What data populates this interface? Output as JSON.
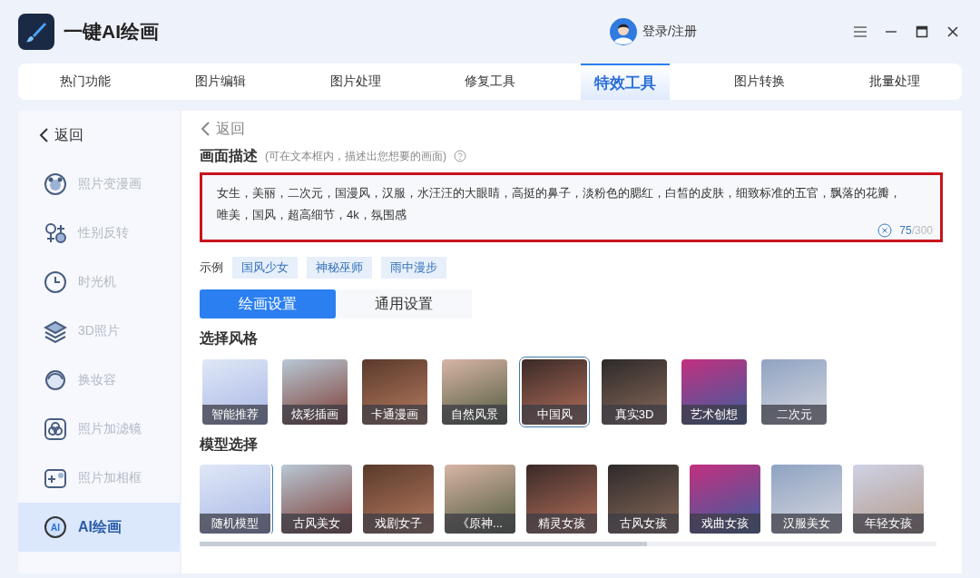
{
  "app": {
    "title": "一键AI绘画",
    "login": "登录/注册"
  },
  "tabs": [
    {
      "label": "热门功能",
      "selected": false
    },
    {
      "label": "图片编辑",
      "selected": false
    },
    {
      "label": "图片处理",
      "selected": false
    },
    {
      "label": "修复工具",
      "selected": false
    },
    {
      "label": "特效工具",
      "selected": true
    },
    {
      "label": "图片转换",
      "selected": false
    },
    {
      "label": "批量处理",
      "selected": false
    }
  ],
  "sidebar": {
    "back": "返回",
    "items": [
      {
        "label": "照片变漫画",
        "selected": false
      },
      {
        "label": "性别反转",
        "selected": false
      },
      {
        "label": "时光机",
        "selected": false
      },
      {
        "label": "3D照片",
        "selected": false
      },
      {
        "label": "换妆容",
        "selected": false
      },
      {
        "label": "照片加滤镜",
        "selected": false
      },
      {
        "label": "照片加相框",
        "selected": false
      },
      {
        "label": "AI绘画",
        "selected": true,
        "icon_text": "AI"
      }
    ]
  },
  "main": {
    "back": "返回",
    "description_title": "画面描述",
    "description_hint": "(可在文本框内，描述出您想要的画面)",
    "description": "女生，美丽，二次元，国漫风，汉服，水汪汪的大眼睛，高挺的鼻子，淡粉色的腮红，白皙的皮肤，细致标准的五官，飘落的花瓣，唯美，国风，超高细节，4k，氛围感",
    "count": "75",
    "limit": "/300",
    "examples_label": "示例",
    "examples": [
      "国风少女",
      "神秘巫师",
      "雨中漫步"
    ],
    "settings_tabs": [
      {
        "label": "绘画设置",
        "selected": true
      },
      {
        "label": "通用设置",
        "selected": false
      }
    ],
    "style_title": "选择风格",
    "styles": [
      {
        "label": "智能推荐",
        "selected": false
      },
      {
        "label": "炫彩插画",
        "selected": false
      },
      {
        "label": "卡通漫画",
        "selected": false
      },
      {
        "label": "自然风景",
        "selected": false
      },
      {
        "label": "中国风",
        "selected": true
      },
      {
        "label": "真实3D",
        "selected": false
      },
      {
        "label": "艺术创想",
        "selected": false
      },
      {
        "label": "二次元",
        "selected": false
      }
    ],
    "model_title": "模型选择",
    "models": [
      {
        "label": "随机模型",
        "selected": true
      },
      {
        "label": "古风美女",
        "selected": false
      },
      {
        "label": "戏剧女子",
        "selected": false
      },
      {
        "label": "《原神...",
        "selected": false
      },
      {
        "label": "精灵女孩",
        "selected": false
      },
      {
        "label": "古风女孩",
        "selected": false
      },
      {
        "label": "戏曲女孩",
        "selected": false
      },
      {
        "label": "汉服美女",
        "selected": false
      },
      {
        "label": "年轻女孩",
        "selected": false
      }
    ]
  }
}
